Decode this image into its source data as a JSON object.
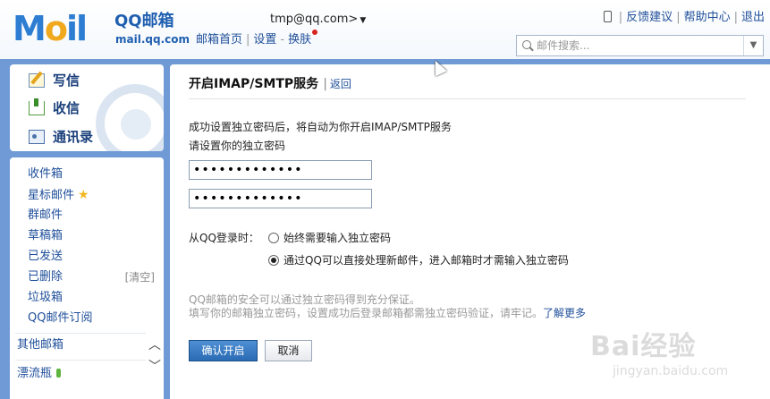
{
  "header": {
    "logo_name": "QQ邮箱",
    "logo_domain": "mail.qq.com",
    "account": "tmp@qq.com>",
    "nav": [
      "邮箱首页",
      "设置",
      "换肤"
    ],
    "top_links": [
      "反馈建议",
      "帮助中心",
      "退出"
    ],
    "search_placeholder": "邮件搜索..."
  },
  "sidebar": {
    "actions": [
      "写信",
      "收信",
      "通讯录"
    ],
    "folders": [
      "收件箱",
      "星标邮件",
      "群邮件",
      "草稿箱",
      "已发送",
      "已删除",
      "垃圾箱",
      "QQ邮件订阅"
    ],
    "clear_label": "[清空]",
    "other_mailbox": "其他邮箱",
    "drift_bottle": "漂流瓶"
  },
  "main": {
    "title": "开启IMAP/SMTP服务",
    "back_link": "返回",
    "desc_line1": "成功设置独立密码后，将自动为你开启IMAP/SMTP服务",
    "desc_line2": "请设置你的独立密码",
    "password1": "•••••••••••••",
    "password2": "•••••••••••••",
    "login_label": "从QQ登录时：",
    "option_always": "始终需要输入独立密码",
    "option_direct": "通过QQ可以直接处理新邮件，进入邮箱时才需输入独立密码",
    "selected_option": "option_direct",
    "note_line1": "QQ邮箱的安全可以通过独立密码得到充分保证。",
    "note_line2": "填写你的邮箱独立密码，设置成功后登录邮箱都需独立密码验证，请牢记。",
    "learn_more": "了解更多",
    "confirm_button": "确认开启",
    "cancel_button": "取消"
  },
  "watermark": {
    "brand": "Bai经验",
    "url": "jingyan.baidu.com"
  },
  "colors": {
    "frame_blue": "#6f9ad6",
    "link_blue": "#1f4f9a",
    "primary_button": "#2a6bb4"
  }
}
